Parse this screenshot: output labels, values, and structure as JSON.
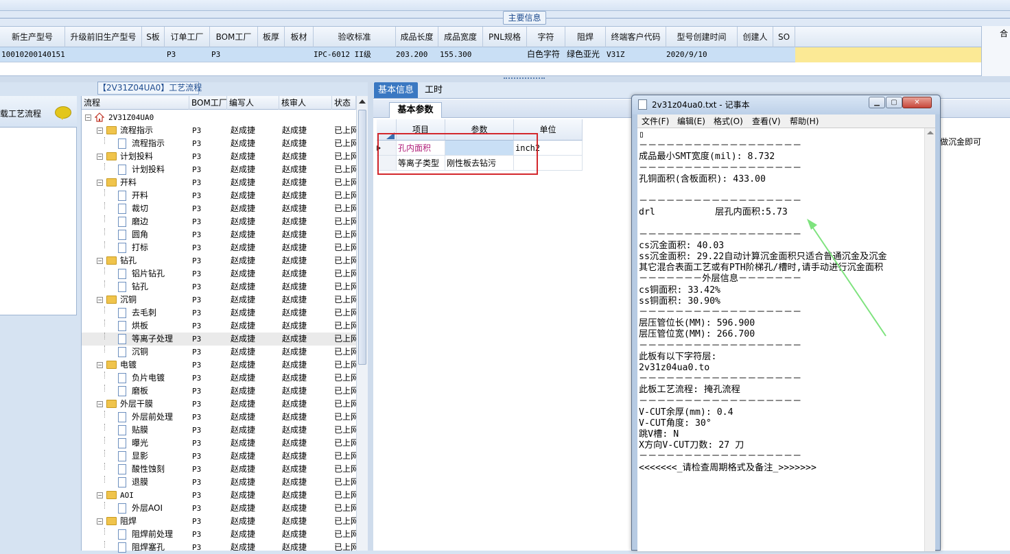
{
  "header": {
    "section_label": "主要信息",
    "columns": [
      "新生产型号",
      "升级前旧生产型号",
      "S板",
      "订单工厂",
      "BOM工厂",
      "板厚",
      "板材",
      "验收标准",
      "成品长度",
      "成品宽度",
      "PNL规格",
      "字符",
      "阻焊",
      "终端客户代码",
      "型号创建时间",
      "创建人",
      "SO"
    ],
    "row": [
      "10010200140151",
      "",
      "",
      "P3",
      "P3",
      "",
      "",
      "IPC-6012 II级",
      "203.200",
      "155.300",
      "",
      "白色字符",
      "绿色亚光",
      "V31Z",
      "2020/9/10",
      "",
      ""
    ],
    "right_panel_label": "合"
  },
  "left_panel": {
    "label": "载工艺流程"
  },
  "process_tree": {
    "title": "【2V31Z04UA0】工艺流程",
    "columns": [
      "流程",
      "BOM工厂",
      "编写人",
      "核审人",
      "状态"
    ],
    "rows": [
      {
        "level": 0,
        "kind": "root",
        "name": "2V31Z04UA0",
        "bom": "",
        "author": "",
        "reviewer": "",
        "status": ""
      },
      {
        "level": 1,
        "kind": "folder",
        "name": "流程指示",
        "bom": "P3",
        "author": "赵成捷",
        "reviewer": "赵成捷",
        "status": "已上网"
      },
      {
        "level": 2,
        "kind": "doc",
        "name": "流程指示",
        "bom": "P3",
        "author": "赵成捷",
        "reviewer": "赵成捷",
        "status": "已上网"
      },
      {
        "level": 1,
        "kind": "folder",
        "name": "计划投料",
        "bom": "P3",
        "author": "赵成捷",
        "reviewer": "赵成捷",
        "status": "已上网"
      },
      {
        "level": 2,
        "kind": "doc",
        "name": "计划投料",
        "bom": "P3",
        "author": "赵成捷",
        "reviewer": "赵成捷",
        "status": "已上网"
      },
      {
        "level": 1,
        "kind": "folder",
        "name": "开料",
        "bom": "P3",
        "author": "赵成捷",
        "reviewer": "赵成捷",
        "status": "已上网"
      },
      {
        "level": 2,
        "kind": "doc",
        "name": "开料",
        "bom": "P3",
        "author": "赵成捷",
        "reviewer": "赵成捷",
        "status": "已上网"
      },
      {
        "level": 2,
        "kind": "doc",
        "name": "裁切",
        "bom": "P3",
        "author": "赵成捷",
        "reviewer": "赵成捷",
        "status": "已上网"
      },
      {
        "level": 2,
        "kind": "doc",
        "name": "磨边",
        "bom": "P3",
        "author": "赵成捷",
        "reviewer": "赵成捷",
        "status": "已上网"
      },
      {
        "level": 2,
        "kind": "doc",
        "name": "圆角",
        "bom": "P3",
        "author": "赵成捷",
        "reviewer": "赵成捷",
        "status": "已上网"
      },
      {
        "level": 2,
        "kind": "doc",
        "name": "打标",
        "bom": "P3",
        "author": "赵成捷",
        "reviewer": "赵成捷",
        "status": "已上网"
      },
      {
        "level": 1,
        "kind": "folder",
        "name": "钻孔",
        "bom": "P3",
        "author": "赵成捷",
        "reviewer": "赵成捷",
        "status": "已上网"
      },
      {
        "level": 2,
        "kind": "doc",
        "name": "铝片钻孔",
        "bom": "P3",
        "author": "赵成捷",
        "reviewer": "赵成捷",
        "status": "已上网"
      },
      {
        "level": 2,
        "kind": "doc",
        "name": "钻孔",
        "bom": "P3",
        "author": "赵成捷",
        "reviewer": "赵成捷",
        "status": "已上网"
      },
      {
        "level": 1,
        "kind": "folder",
        "name": "沉铜",
        "bom": "P3",
        "author": "赵成捷",
        "reviewer": "赵成捷",
        "status": "已上网"
      },
      {
        "level": 2,
        "kind": "doc",
        "name": "去毛刺",
        "bom": "P3",
        "author": "赵成捷",
        "reviewer": "赵成捷",
        "status": "已上网"
      },
      {
        "level": 2,
        "kind": "doc",
        "name": "烘板",
        "bom": "P3",
        "author": "赵成捷",
        "reviewer": "赵成捷",
        "status": "已上网"
      },
      {
        "level": 2,
        "kind": "doc",
        "name": "等离子处理",
        "bom": "P3",
        "author": "赵成捷",
        "reviewer": "赵成捷",
        "status": "已上网",
        "selected": true
      },
      {
        "level": 2,
        "kind": "doc",
        "name": "沉铜",
        "bom": "P3",
        "author": "赵成捷",
        "reviewer": "赵成捷",
        "status": "已上网"
      },
      {
        "level": 1,
        "kind": "folder",
        "name": "电镀",
        "bom": "P3",
        "author": "赵成捷",
        "reviewer": "赵成捷",
        "status": "已上网"
      },
      {
        "level": 2,
        "kind": "doc",
        "name": "负片电镀",
        "bom": "P3",
        "author": "赵成捷",
        "reviewer": "赵成捷",
        "status": "已上网"
      },
      {
        "level": 2,
        "kind": "doc",
        "name": "磨板",
        "bom": "P3",
        "author": "赵成捷",
        "reviewer": "赵成捷",
        "status": "已上网"
      },
      {
        "level": 1,
        "kind": "folder",
        "name": "外层干膜",
        "bom": "P3",
        "author": "赵成捷",
        "reviewer": "赵成捷",
        "status": "已上网"
      },
      {
        "level": 2,
        "kind": "doc",
        "name": "外层前处理",
        "bom": "P3",
        "author": "赵成捷",
        "reviewer": "赵成捷",
        "status": "已上网"
      },
      {
        "level": 2,
        "kind": "doc",
        "name": "贴膜",
        "bom": "P3",
        "author": "赵成捷",
        "reviewer": "赵成捷",
        "status": "已上网"
      },
      {
        "level": 2,
        "kind": "doc",
        "name": "曝光",
        "bom": "P3",
        "author": "赵成捷",
        "reviewer": "赵成捷",
        "status": "已上网"
      },
      {
        "level": 2,
        "kind": "doc",
        "name": "显影",
        "bom": "P3",
        "author": "赵成捷",
        "reviewer": "赵成捷",
        "status": "已上网"
      },
      {
        "level": 2,
        "kind": "doc",
        "name": "酸性蚀刻",
        "bom": "P3",
        "author": "赵成捷",
        "reviewer": "赵成捷",
        "status": "已上网"
      },
      {
        "level": 2,
        "kind": "doc",
        "name": "退膜",
        "bom": "P3",
        "author": "赵成捷",
        "reviewer": "赵成捷",
        "status": "已上网"
      },
      {
        "level": 1,
        "kind": "folder",
        "name": "AOI",
        "bom": "P3",
        "author": "赵成捷",
        "reviewer": "赵成捷",
        "status": "已上网"
      },
      {
        "level": 2,
        "kind": "doc",
        "name": "外层AOI",
        "bom": "P3",
        "author": "赵成捷",
        "reviewer": "赵成捷",
        "status": "已上网"
      },
      {
        "level": 1,
        "kind": "folder",
        "name": "阻焊",
        "bom": "P3",
        "author": "赵成捷",
        "reviewer": "赵成捷",
        "status": "已上网"
      },
      {
        "level": 2,
        "kind": "doc",
        "name": "阻焊前处理",
        "bom": "P3",
        "author": "赵成捷",
        "reviewer": "赵成捷",
        "status": "已上网"
      },
      {
        "level": 2,
        "kind": "doc",
        "name": "阻焊塞孔",
        "bom": "P3",
        "author": "赵成捷",
        "reviewer": "赵成捷",
        "status": "已上网"
      }
    ]
  },
  "middle": {
    "tabs": [
      "基本信息",
      "工时"
    ],
    "subtab": "基本参数",
    "param_columns": [
      "项目",
      "参数",
      "单位"
    ],
    "params": [
      {
        "item": "孔内面积",
        "value": "",
        "unit": "inch2"
      },
      {
        "item": "等离子类型",
        "value": "刚性板去钻污",
        "unit": ""
      }
    ],
    "right_fragment": "做沉金即可"
  },
  "notepad": {
    "title": "2v31z04ua0.txt - 记事本",
    "menu": [
      "文件(F)",
      "编辑(E)",
      "格式(O)",
      "查看(V)",
      "帮助(H)"
    ],
    "lines": [
      "▯",
      "－－－－－－－－－－－－－－－－－－",
      "成品最小SMT宽度(mil): 8.732",
      "－－－－－－－－－－－－－－－－－－",
      "孔铜面积(含板面积): 433.00",
      "",
      "－－－－－－－－－－－－－－－－－－",
      "drl           层孔内面积:5.73",
      "",
      "－－－－－－－－－－－－－－－－－－",
      "cs沉金面积: 40.03",
      "ss沉金面积: 29.22自动计算沉金面积只适合普通沉金及沉金",
      "其它混合表面工艺或有PTH阶梯孔/槽时,请手动进行沉金面积",
      "－－－－－－－外层信息－－－－－－－",
      "cs铜面积: 33.42%",
      "ss铜面积: 30.90%",
      "－－－－－－－－－－－－－－－－－－",
      "层压管位长(MM): 596.900",
      "层压管位宽(MM): 266.700",
      "－－－－－－－－－－－－－－－－－－",
      "此板有以下字符层:",
      "2v31z04ua0.to",
      "－－－－－－－－－－－－－－－－－－",
      "此板工艺流程: 掩孔流程",
      "－－－－－－－－－－－－－－－－－－",
      "V-CUT余厚(mm): 0.4",
      "V-CUT角度: 30°",
      "跳V槽: N",
      "X方向V-CUT刀数: 27 刀",
      "－－－－－－－－－－－－－－－－－－",
      "<<<<<<<_请检查周期格式及备注_>>>>>>>"
    ]
  },
  "colors": {
    "selected_row": "#c9dff5",
    "highlight_yellow": "#fbe995",
    "tab_active": "#3a78c2",
    "red_box": "#d3262b",
    "annotation_arrow": "#7ee37e"
  }
}
